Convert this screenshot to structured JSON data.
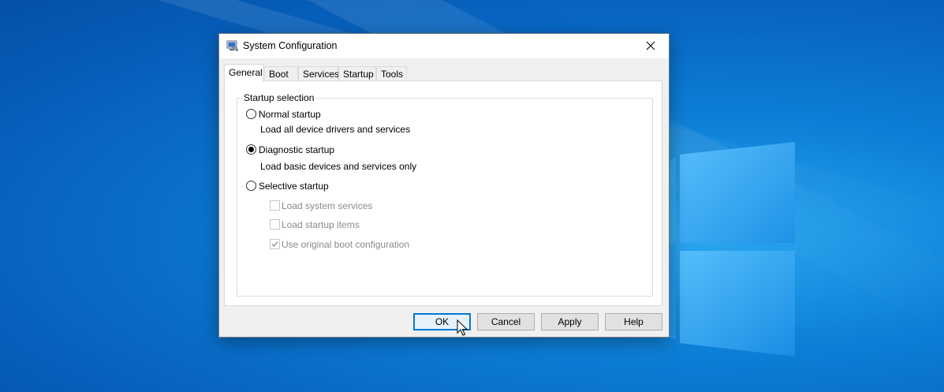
{
  "window": {
    "title": "System Configuration",
    "icon": "msconfig-icon",
    "close_icon": "close-icon"
  },
  "tabs": [
    {
      "label": "General",
      "active": true
    },
    {
      "label": "Boot",
      "active": false
    },
    {
      "label": "Services",
      "active": false
    },
    {
      "label": "Startup",
      "active": false
    },
    {
      "label": "Tools",
      "active": false
    }
  ],
  "general": {
    "group_title": "Startup selection",
    "normal": {
      "label": "Normal startup",
      "description": "Load all device drivers and services",
      "selected": false
    },
    "diagnostic": {
      "label": "Diagnostic startup",
      "description": "Load basic devices and services only",
      "selected": true
    },
    "selective": {
      "label": "Selective startup",
      "selected": false,
      "options": [
        {
          "label": "Load system services",
          "checked": false,
          "enabled": false
        },
        {
          "label": "Load startup items",
          "checked": false,
          "enabled": false
        },
        {
          "label": "Use original boot configuration",
          "checked": true,
          "enabled": false
        }
      ]
    }
  },
  "buttons": {
    "ok": "OK",
    "cancel": "Cancel",
    "apply": "Apply",
    "help": "Help"
  },
  "colors": {
    "desktop": "#0a6fd0",
    "accent": "#0078d7"
  }
}
